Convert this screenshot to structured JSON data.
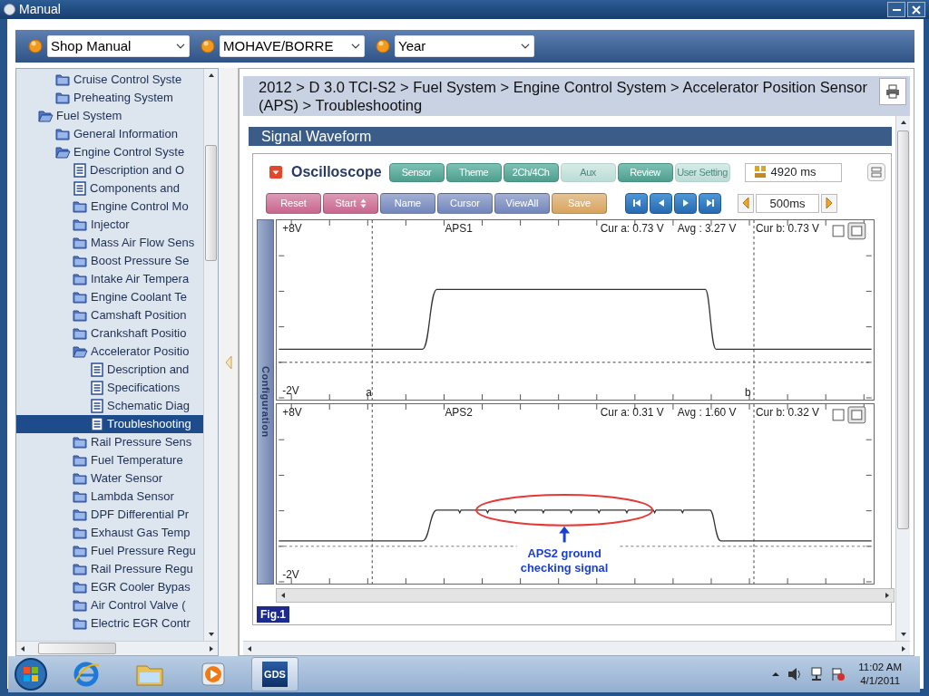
{
  "window": {
    "title": "Manual"
  },
  "selectors": [
    {
      "value": "Shop Manual"
    },
    {
      "value": "MOHAVE/BORRE"
    },
    {
      "value": "Year"
    }
  ],
  "tree": {
    "items": [
      {
        "children": [
          {
            "label": "Cruise Control Syste",
            "kind": "folder",
            "expanded": false,
            "selected": false
          },
          {
            "label": "Preheating System",
            "kind": "folder",
            "expanded": false,
            "selected": false
          }
        ]
      },
      {
        "label": "Fuel System",
        "kind": "folder",
        "expanded": true,
        "selected": false,
        "children": [
          {
            "label": "General Information",
            "kind": "folder",
            "expanded": false,
            "selected": false
          },
          {
            "label": "Engine Control Syste",
            "kind": "folder",
            "expanded": true,
            "selected": false,
            "children": [
              {
                "label": "Description and O",
                "kind": "doc",
                "selected": false
              },
              {
                "label": "Components and",
                "kind": "doc",
                "selected": false
              },
              {
                "label": "Engine Control Mo",
                "kind": "folder",
                "expanded": false,
                "selected": false
              },
              {
                "label": "Injector",
                "kind": "folder",
                "expanded": false,
                "selected": false
              },
              {
                "label": "Mass Air Flow Sens",
                "kind": "folder",
                "expanded": false,
                "selected": false
              },
              {
                "label": "Boost Pressure Se",
                "kind": "folder",
                "expanded": false,
                "selected": false
              },
              {
                "label": "Intake Air Tempera",
                "kind": "folder",
                "expanded": false,
                "selected": false
              },
              {
                "label": "Engine Coolant Te",
                "kind": "folder",
                "expanded": false,
                "selected": false
              },
              {
                "label": "Camshaft Position",
                "kind": "folder",
                "expanded": false,
                "selected": false
              },
              {
                "label": "Crankshaft Positio",
                "kind": "folder",
                "expanded": false,
                "selected": false
              },
              {
                "label": "Accelerator Positio",
                "kind": "folder",
                "expanded": true,
                "selected": false,
                "children": [
                  {
                    "label": "Description and",
                    "kind": "doc",
                    "selected": false
                  },
                  {
                    "label": "Specifications",
                    "kind": "doc",
                    "selected": false
                  },
                  {
                    "label": "Schematic Diag",
                    "kind": "doc",
                    "selected": false
                  },
                  {
                    "label": "Troubleshooting",
                    "kind": "doc",
                    "selected": true
                  }
                ]
              },
              {
                "label": "Rail Pressure Sens",
                "kind": "folder",
                "expanded": false,
                "selected": false
              },
              {
                "label": "Fuel Temperature",
                "kind": "folder",
                "expanded": false,
                "selected": false
              },
              {
                "label": "Water Sensor",
                "kind": "folder",
                "expanded": false,
                "selected": false
              },
              {
                "label": "Lambda Sensor",
                "kind": "folder",
                "expanded": false,
                "selected": false
              },
              {
                "label": "DPF Differential Pr",
                "kind": "folder",
                "expanded": false,
                "selected": false
              },
              {
                "label": "Exhaust Gas Temp",
                "kind": "folder",
                "expanded": false,
                "selected": false
              },
              {
                "label": "Fuel Pressure Regu",
                "kind": "folder",
                "expanded": false,
                "selected": false
              },
              {
                "label": "Rail Pressure Regu",
                "kind": "folder",
                "expanded": false,
                "selected": false
              },
              {
                "label": "EGR Cooler Bypas",
                "kind": "folder",
                "expanded": false,
                "selected": false
              },
              {
                "label": "Air Control Valve (",
                "kind": "folder",
                "expanded": false,
                "selected": false
              },
              {
                "label": "Electric EGR Contr",
                "kind": "folder",
                "expanded": false,
                "selected": false
              }
            ]
          }
        ]
      }
    ]
  },
  "breadcrumb": "2012 > D 3.0 TCI-S2 > Fuel System > Engine Control System > Accelerator Position Sensor (APS) > Troubleshooting",
  "section_title": "Signal Waveform",
  "oscilloscope": {
    "title": "Oscilloscope",
    "mode_buttons": [
      {
        "label": "Sensor",
        "disabled": false
      },
      {
        "label": "Theme",
        "disabled": false
      },
      {
        "label": "2Ch/4Ch",
        "disabled": false
      },
      {
        "label": "Aux",
        "disabled": true
      },
      {
        "label": "Review",
        "disabled": false
      },
      {
        "label": "User Setting",
        "disabled": true
      }
    ],
    "time": "4920 ms",
    "action_buttons": [
      {
        "label": "Reset",
        "kind": "plain",
        "color": "#c8668e"
      },
      {
        "label": "Start",
        "kind": "spinner",
        "color": "#c8668e"
      },
      {
        "label": "Name",
        "kind": "plain",
        "color": "#7286bb"
      },
      {
        "label": "Cursor",
        "kind": "plain",
        "color": "#7286bb"
      },
      {
        "label": "ViewAll",
        "kind": "plain",
        "color": "#7286bb"
      },
      {
        "label": "Save",
        "kind": "plain",
        "color": "#d7a45e"
      }
    ],
    "interval": "500ms",
    "side_tab": "Configuration",
    "channels": [
      {
        "name": "APS1",
        "max": "+8V",
        "min": "-2V",
        "cur_a": "Cur a: 0.73 V",
        "avg": "Avg  : 3.27 V",
        "cur_b": "Cur b: 0.73 V",
        "checked": false,
        "cursor_labels": [
          "a",
          "b"
        ]
      },
      {
        "name": "APS2",
        "max": "+8V",
        "min": "-2V",
        "cur_a": "Cur a: 0.31 V",
        "avg": "Avg  : 1.60 V",
        "cur_b": "Cur b: 0.32 V",
        "checked": false,
        "annotation": [
          "APS2 ground",
          "checking signal"
        ]
      }
    ]
  },
  "figure_label": "Fig.1",
  "taskbar": {
    "apps": [
      {
        "kind": "browser",
        "active": false
      },
      {
        "kind": "explorer",
        "active": false
      },
      {
        "kind": "media",
        "active": false
      },
      {
        "kind": "gds",
        "label": "GDS",
        "active": true
      }
    ],
    "time": "11:02 AM",
    "date": "4/1/2011"
  }
}
